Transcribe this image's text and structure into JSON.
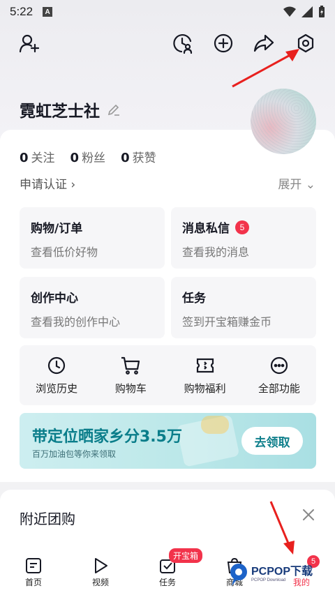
{
  "status_bar": {
    "time": "5:22",
    "notification_letter": "A"
  },
  "profile": {
    "name": "霓虹芝士社",
    "stats": [
      {
        "count": "0",
        "label": "关注"
      },
      {
        "count": "0",
        "label": "粉丝"
      },
      {
        "count": "0",
        "label": "获赞"
      }
    ],
    "apply_cert": "申请认证 ›",
    "expand": "展开 ⌄"
  },
  "tiles": [
    {
      "title": "购物/订单",
      "subtitle": "查看低价好物"
    },
    {
      "title": "消息私信",
      "subtitle": "查看我的消息",
      "badge": "5"
    },
    {
      "title": "创作中心",
      "subtitle": "查看我的创作中心"
    },
    {
      "title": "任务",
      "subtitle": "签到开宝箱赚金币"
    }
  ],
  "quick_actions": [
    {
      "label": "浏览历史",
      "icon": "clock-icon"
    },
    {
      "label": "购物车",
      "icon": "cart-icon"
    },
    {
      "label": "购物福利",
      "icon": "ticket-icon"
    },
    {
      "label": "全部功能",
      "icon": "more-icon"
    }
  ],
  "banner": {
    "title": "带定位晒家乡分3.5万",
    "subtitle": "百万加油包等你来领取",
    "button": "去领取"
  },
  "nearby": {
    "title": "附近团购"
  },
  "tabbar": {
    "tabs": [
      {
        "label": "首页"
      },
      {
        "label": "视频"
      },
      {
        "label": "任务",
        "badge": "开宝箱"
      },
      {
        "label": "商城"
      },
      {
        "label": "我的",
        "badge": "5"
      }
    ]
  },
  "watermark": {
    "brand": "PCPOP下载",
    "sub": "PCPOP Download"
  },
  "colors": {
    "accent_red": "#f2334b",
    "banner_teal": "#0a7d8a"
  }
}
